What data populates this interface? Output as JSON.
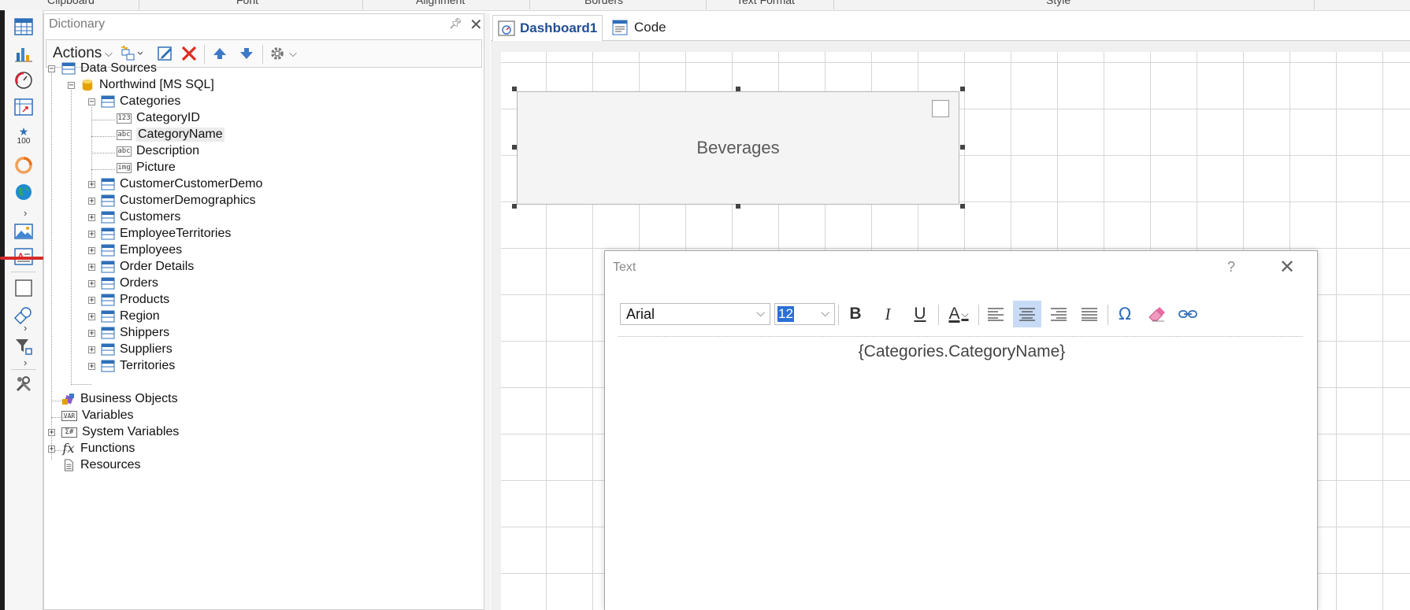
{
  "ribbon": {
    "groups": [
      "Clipboard",
      "Font",
      "Alignment",
      "Borders",
      "Text Format",
      "Style"
    ]
  },
  "toolbox": {
    "items": [
      "table-icon",
      "chart-icon",
      "gauge-icon",
      "pivot-table-icon",
      "indicator-icon",
      "progress-icon",
      "region-map-icon",
      "image-icon",
      "text-icon",
      "panel-icon",
      "shape-icon",
      "filter-icon",
      "settings-icon"
    ],
    "indicator_value": "100"
  },
  "dictionary": {
    "title": "Dictionary",
    "actions_label": "Actions",
    "tree": {
      "data_sources": "Data Sources",
      "connection": "Northwind [MS SQL]",
      "categories": "Categories",
      "columns": [
        {
          "name": "CategoryID",
          "type": "123"
        },
        {
          "name": "CategoryName",
          "type": "abc"
        },
        {
          "name": "Description",
          "type": "abc"
        },
        {
          "name": "Picture",
          "type": "img"
        }
      ],
      "tables": [
        "CustomerCustomerDemo",
        "CustomerDemographics",
        "Customers",
        "EmployeeTerritories",
        "Employees",
        "Order Details",
        "Orders",
        "Products",
        "Region",
        "Shippers",
        "Suppliers",
        "Territories"
      ],
      "roots": [
        {
          "label": "Business Objects",
          "icon": "business-objects-icon"
        },
        {
          "label": "Variables",
          "icon": "variables-icon",
          "badge": "VAR"
        },
        {
          "label": "System Variables",
          "icon": "system-variables-icon",
          "badge": "Σ#"
        },
        {
          "label": "Functions",
          "icon": "functions-icon",
          "badge": "fx"
        },
        {
          "label": "Resources",
          "icon": "resources-icon"
        }
      ]
    }
  },
  "tabs": [
    {
      "label": "Dashboard1",
      "active": true
    },
    {
      "label": "Code",
      "active": false
    }
  ],
  "canvas": {
    "element_text": "Beverages"
  },
  "text_dialog": {
    "title": "Text",
    "help": "?",
    "font": "Arial",
    "size": "12",
    "format_buttons": {
      "bold": "B",
      "italic": "I",
      "underline": "U",
      "color": "A",
      "omega": "Ω"
    },
    "expression": "{Categories.CategoryName}"
  },
  "colors": {
    "accent": "#1f4e96",
    "selection": "#c8dbf6",
    "delete_red": "#e02b20",
    "arrow_blue": "#3e78c8"
  }
}
